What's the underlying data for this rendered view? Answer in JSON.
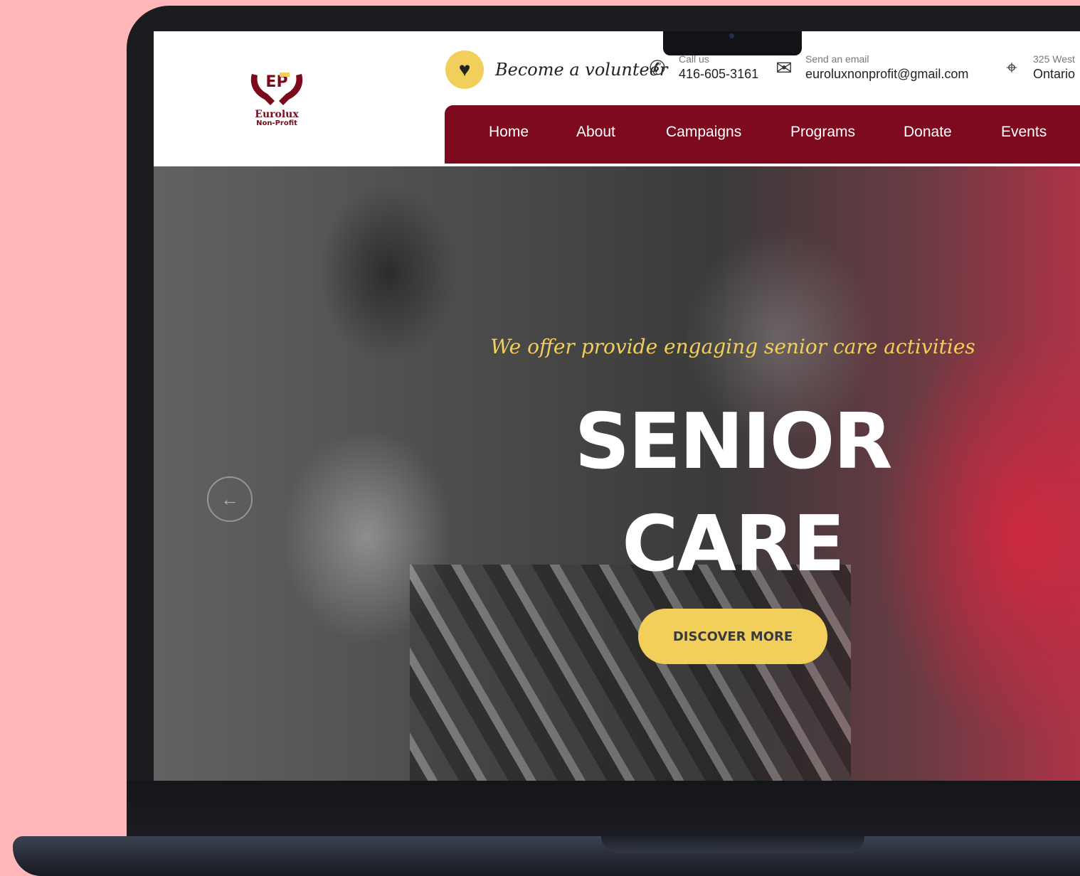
{
  "brand": {
    "name": "Eurolux",
    "sub": "Non-Profit",
    "initials": "EP"
  },
  "header": {
    "volunteer_label": "Become a volunteer",
    "call": {
      "label": "Call us",
      "value": "416-605-3161"
    },
    "email": {
      "label": "Send an email",
      "value": "euroluxnonprofit@gmail.com"
    },
    "address": {
      "label": "325 West",
      "value": "Ontario"
    }
  },
  "nav": {
    "items": [
      "Home",
      "About",
      "Campaigns",
      "Programs",
      "Donate",
      "Events"
    ]
  },
  "hero": {
    "tagline": "We offer provide engaging senior care activities",
    "title": "SENIOR CARE",
    "cta": "DISCOVER MORE"
  },
  "colors": {
    "brand": "#7d0a1f",
    "accent": "#f2cf5a",
    "background": "#ffb7ba"
  },
  "icons": {
    "volunteer": "heart-icon",
    "call": "phone-icon",
    "email": "envelope-icon",
    "address": "map-pin-icon",
    "slider_prev": "arrow-left-icon"
  }
}
